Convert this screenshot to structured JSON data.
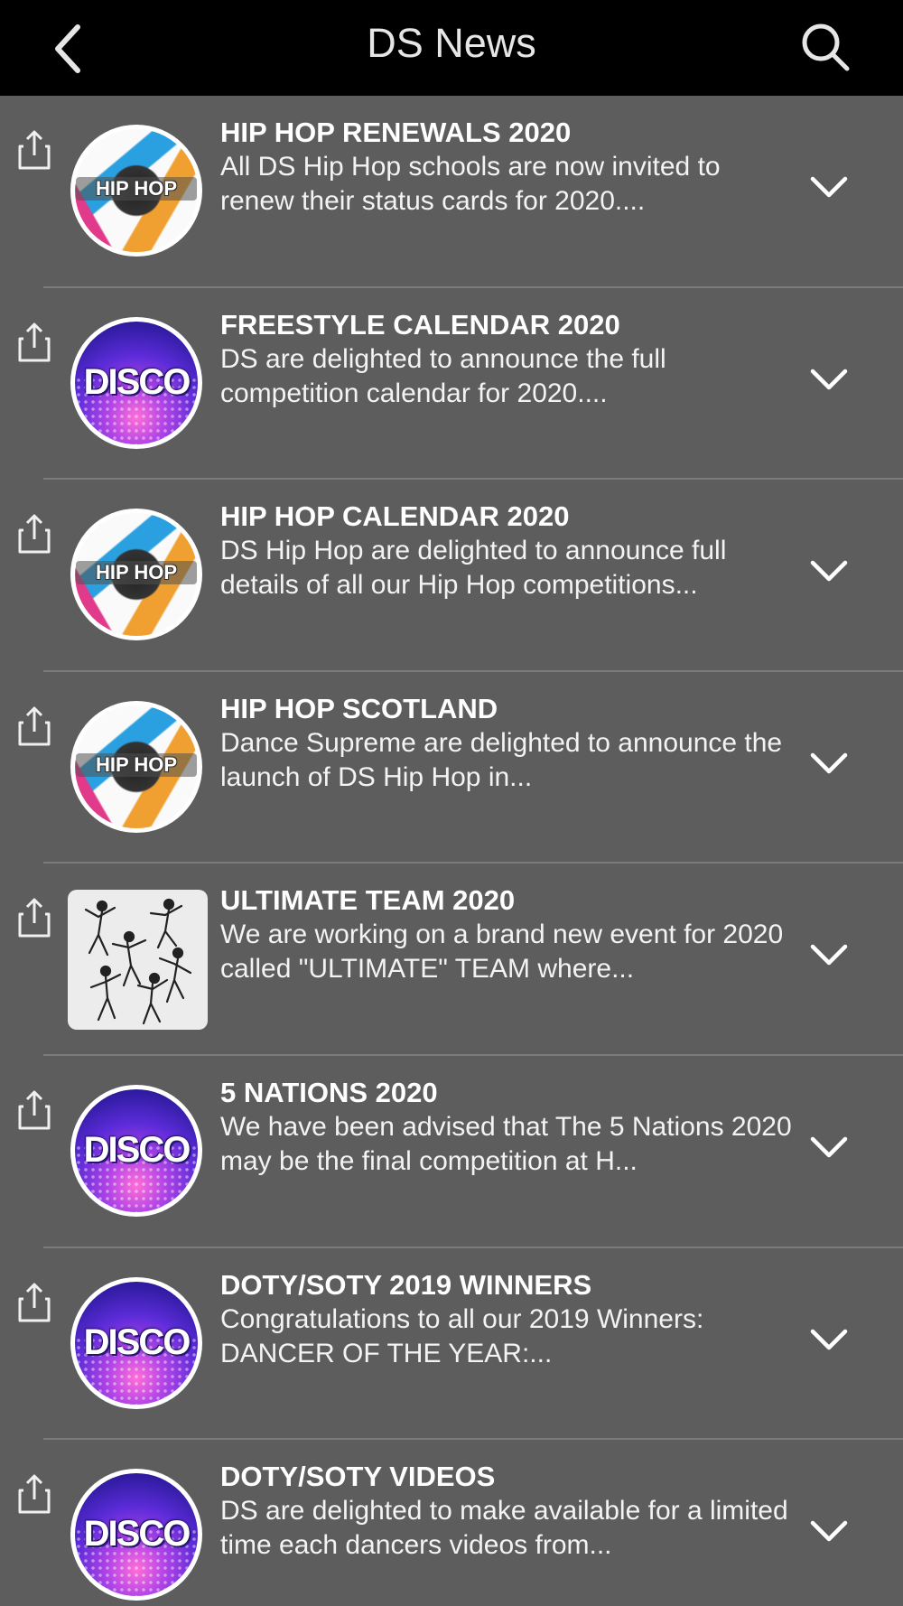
{
  "header": {
    "title": "DS News",
    "back_icon": "chevron-left-icon",
    "search_icon": "search-icon"
  },
  "colors": {
    "header_bg": "#000000",
    "list_bg": "#5d5d5d",
    "divider": "#7b7b7b",
    "text": "#ffffff"
  },
  "news": [
    {
      "title": "HIP HOP RENEWALS 2020",
      "description": "All DS Hip Hop schools are now invited to renew their status cards for 2020....",
      "image": "HIP HOP",
      "image_type": "hiphop"
    },
    {
      "title": "FREESTYLE CALENDAR 2020",
      "description": "DS are delighted to announce the full competition calendar for 2020....",
      "image": "DISCO",
      "image_type": "disco"
    },
    {
      "title": "HIP HOP CALENDAR 2020",
      "description": "DS Hip Hop are delighted to announce full details of all our Hip Hop competitions...",
      "image": "HIP HOP",
      "image_type": "hiphop"
    },
    {
      "title": "HIP HOP SCOTLAND",
      "description": "Dance Supreme are delighted to announce the launch of DS Hip Hop in...",
      "image": "HIP HOP",
      "image_type": "hiphop"
    },
    {
      "title": "ULTIMATE TEAM 2020",
      "description": "We are working on a brand new event for 2020 called \"ULTIMATE\" TEAM where...",
      "image": "",
      "image_type": "dancers"
    },
    {
      "title": "5 NATIONS 2020",
      "description": "We have been advised that The 5 Nations 2020 may be the final competition at H...",
      "image": "DISCO",
      "image_type": "disco"
    },
    {
      "title": "DOTY/SOTY 2019 WINNERS",
      "description": "Congratulations to all our 2019 Winners: DANCER OF THE YEAR:...",
      "image": "DISCO",
      "image_type": "disco"
    },
    {
      "title": "DOTY/SOTY VIDEOS",
      "description": "DS are delighted to make available for a limited time each dancers videos from...",
      "image": "DISCO",
      "image_type": "disco"
    }
  ]
}
